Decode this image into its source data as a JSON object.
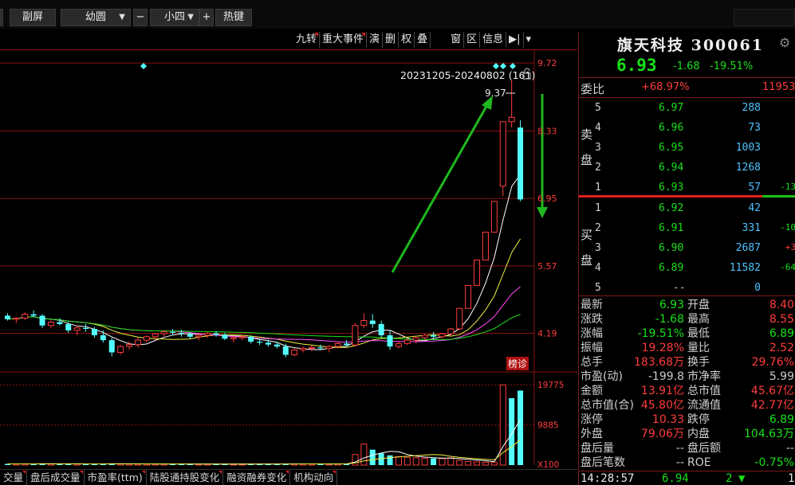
{
  "toolbar": {
    "sub_screen": "副屏",
    "font_family": "幼圆",
    "zoom_out": "−",
    "font_size": "小四",
    "zoom_in": "+",
    "hotkeys": "热键"
  },
  "chart_toolbar": {
    "items": [
      "九转",
      "重大事件",
      "演",
      "删",
      "权",
      "叠",
      "窗",
      "区",
      "信息"
    ],
    "arrow_icon": "skip-right-icon",
    "dropdown_icon": "chevron-down-icon"
  },
  "chart": {
    "range_label": "20231205-20240802 (161)",
    "lock_icon": "unlock-icon",
    "high_label": "9.37",
    "badge": "榜诊",
    "price_ticks": [
      "9.72",
      "8.33",
      "6.95",
      "5.57",
      "4.19"
    ],
    "volume_ticks": [
      "19775",
      "9885",
      "X100"
    ]
  },
  "chart_data": [
    {
      "type": "candlestick",
      "y_ticks": [
        4.19,
        5.57,
        6.95,
        8.33,
        9.72
      ],
      "ylim": [
        3.4,
        10.0
      ],
      "candles": [
        {
          "o": 4.55,
          "h": 4.6,
          "l": 4.45,
          "c": 4.48
        },
        {
          "o": 4.48,
          "h": 4.52,
          "l": 4.4,
          "c": 4.5
        },
        {
          "o": 4.5,
          "h": 4.62,
          "l": 4.46,
          "c": 4.58
        },
        {
          "o": 4.58,
          "h": 4.66,
          "l": 4.52,
          "c": 4.55
        },
        {
          "o": 4.55,
          "h": 4.58,
          "l": 4.3,
          "c": 4.35
        },
        {
          "o": 4.35,
          "h": 4.45,
          "l": 4.3,
          "c": 4.42
        },
        {
          "o": 4.42,
          "h": 4.5,
          "l": 4.35,
          "c": 4.38
        },
        {
          "o": 4.38,
          "h": 4.42,
          "l": 4.2,
          "c": 4.25
        },
        {
          "o": 4.25,
          "h": 4.35,
          "l": 4.15,
          "c": 4.3
        },
        {
          "o": 4.3,
          "h": 4.38,
          "l": 4.22,
          "c": 4.28
        },
        {
          "o": 4.28,
          "h": 4.32,
          "l": 4.1,
          "c": 4.15
        },
        {
          "o": 4.15,
          "h": 4.25,
          "l": 4.0,
          "c": 4.05
        },
        {
          "o": 4.05,
          "h": 4.1,
          "l": 3.72,
          "c": 3.8
        },
        {
          "o": 3.8,
          "h": 3.95,
          "l": 3.75,
          "c": 3.92
        },
        {
          "o": 3.92,
          "h": 4.02,
          "l": 3.85,
          "c": 3.96
        },
        {
          "o": 3.96,
          "h": 4.1,
          "l": 3.9,
          "c": 4.05
        },
        {
          "o": 4.05,
          "h": 4.15,
          "l": 4.0,
          "c": 4.12
        },
        {
          "o": 4.12,
          "h": 4.2,
          "l": 4.05,
          "c": 4.18
        },
        {
          "o": 4.18,
          "h": 4.25,
          "l": 4.12,
          "c": 4.22
        },
        {
          "o": 4.22,
          "h": 4.28,
          "l": 4.15,
          "c": 4.2
        },
        {
          "o": 4.2,
          "h": 4.26,
          "l": 4.12,
          "c": 4.18
        },
        {
          "o": 4.18,
          "h": 4.22,
          "l": 4.08,
          "c": 4.12
        },
        {
          "o": 4.12,
          "h": 4.2,
          "l": 4.05,
          "c": 4.15
        },
        {
          "o": 4.15,
          "h": 4.22,
          "l": 4.1,
          "c": 4.19
        },
        {
          "o": 4.19,
          "h": 4.24,
          "l": 4.12,
          "c": 4.16
        },
        {
          "o": 4.16,
          "h": 4.2,
          "l": 4.05,
          "c": 4.08
        },
        {
          "o": 4.08,
          "h": 4.14,
          "l": 4.0,
          "c": 4.1
        },
        {
          "o": 4.1,
          "h": 4.16,
          "l": 4.05,
          "c": 4.12
        },
        {
          "o": 4.12,
          "h": 4.15,
          "l": 3.98,
          "c": 4.02
        },
        {
          "o": 4.02,
          "h": 4.08,
          "l": 3.95,
          "c": 4.0
        },
        {
          "o": 4.0,
          "h": 4.06,
          "l": 3.92,
          "c": 3.96
        },
        {
          "o": 3.96,
          "h": 4.02,
          "l": 3.88,
          "c": 3.92
        },
        {
          "o": 3.92,
          "h": 3.98,
          "l": 3.7,
          "c": 3.75
        },
        {
          "o": 3.75,
          "h": 3.88,
          "l": 3.72,
          "c": 3.85
        },
        {
          "o": 3.85,
          "h": 3.92,
          "l": 3.8,
          "c": 3.88
        },
        {
          "o": 3.88,
          "h": 3.94,
          "l": 3.82,
          "c": 3.9
        },
        {
          "o": 3.9,
          "h": 3.96,
          "l": 3.85,
          "c": 3.88
        },
        {
          "o": 3.88,
          "h": 3.95,
          "l": 3.8,
          "c": 3.92
        },
        {
          "o": 3.92,
          "h": 4.02,
          "l": 3.88,
          "c": 3.98
        },
        {
          "o": 3.98,
          "h": 4.05,
          "l": 3.92,
          "c": 3.95
        },
        {
          "o": 3.95,
          "h": 4.4,
          "l": 3.92,
          "c": 4.35
        },
        {
          "o": 4.35,
          "h": 4.6,
          "l": 4.3,
          "c": 4.45
        },
        {
          "o": 4.45,
          "h": 4.58,
          "l": 4.3,
          "c": 4.38
        },
        {
          "o": 4.38,
          "h": 4.45,
          "l": 4.1,
          "c": 4.15
        },
        {
          "o": 4.15,
          "h": 4.25,
          "l": 3.85,
          "c": 3.92
        },
        {
          "o": 3.92,
          "h": 4.02,
          "l": 3.88,
          "c": 3.98
        },
        {
          "o": 3.98,
          "h": 4.08,
          "l": 3.95,
          "c": 4.05
        },
        {
          "o": 4.05,
          "h": 4.12,
          "l": 3.98,
          "c": 4.1
        },
        {
          "o": 4.1,
          "h": 4.18,
          "l": 4.05,
          "c": 4.15
        },
        {
          "o": 4.15,
          "h": 4.22,
          "l": 4.08,
          "c": 4.12
        },
        {
          "o": 4.12,
          "h": 4.2,
          "l": 4.08,
          "c": 4.18
        },
        {
          "o": 4.18,
          "h": 4.3,
          "l": 4.15,
          "c": 4.28
        },
        {
          "o": 4.28,
          "h": 4.7,
          "l": 4.25,
          "c": 4.7
        },
        {
          "o": 4.7,
          "h": 5.17,
          "l": 4.7,
          "c": 5.17
        },
        {
          "o": 5.17,
          "h": 5.69,
          "l": 5.17,
          "c": 5.69
        },
        {
          "o": 5.69,
          "h": 6.26,
          "l": 5.69,
          "c": 6.26
        },
        {
          "o": 6.26,
          "h": 6.89,
          "l": 6.26,
          "c": 6.89
        },
        {
          "o": 7.2,
          "h": 8.52,
          "l": 7.0,
          "c": 8.52
        },
        {
          "o": 8.52,
          "h": 9.37,
          "l": 8.4,
          "c": 8.61
        },
        {
          "o": 8.4,
          "h": 8.55,
          "l": 6.89,
          "c": 6.93
        }
      ]
    },
    {
      "type": "bar",
      "title": "volume",
      "y_ticks": [
        9885,
        19775
      ],
      "ylim": [
        0,
        21000
      ],
      "values": [
        300,
        280,
        320,
        290,
        350,
        300,
        280,
        310,
        290,
        270,
        300,
        320,
        360,
        300,
        280,
        270,
        260,
        290,
        280,
        270,
        260,
        250,
        270,
        280,
        260,
        250,
        260,
        270,
        280,
        300,
        290,
        270,
        350,
        300,
        280,
        270,
        260,
        280,
        300,
        320,
        2600,
        5200,
        3800,
        2900,
        2400,
        2100,
        1900,
        1800,
        1700,
        1650,
        1600,
        1800,
        1200,
        900,
        800,
        700,
        650,
        19775,
        16500,
        18368
      ],
      "directions": [
        0,
        1,
        1,
        0,
        0,
        1,
        0,
        0,
        1,
        0,
        0,
        0,
        0,
        1,
        1,
        1,
        1,
        1,
        1,
        0,
        0,
        0,
        1,
        1,
        0,
        0,
        1,
        1,
        0,
        0,
        0,
        0,
        0,
        1,
        1,
        1,
        0,
        1,
        1,
        0,
        1,
        1,
        0,
        0,
        0,
        1,
        1,
        1,
        1,
        0,
        1,
        1,
        1,
        1,
        1,
        1,
        1,
        1,
        0,
        0
      ]
    }
  ],
  "quote": {
    "name_code": "旗天科技 300061",
    "gear_icon": "gear-icon",
    "price": "6.93",
    "change": "-1.68",
    "change_pct": "-19.51%",
    "weibi_label": "委比",
    "weibi_pct": "+68.97%",
    "weibi_diff": "11953",
    "sell_label": [
      "卖",
      "盘"
    ],
    "buy_label": [
      "买",
      "盘"
    ],
    "sell": [
      {
        "lvl": "5",
        "px": "6.97",
        "vol": "288",
        "delta": ""
      },
      {
        "lvl": "4",
        "px": "6.96",
        "vol": "73",
        "delta": ""
      },
      {
        "lvl": "3",
        "px": "6.95",
        "vol": "1003",
        "delta": ""
      },
      {
        "lvl": "2",
        "px": "6.94",
        "vol": "1268",
        "delta": ""
      },
      {
        "lvl": "1",
        "px": "6.93",
        "vol": "57",
        "delta": "-13"
      }
    ],
    "buy": [
      {
        "lvl": "1",
        "px": "6.92",
        "vol": "42",
        "delta": "",
        "dir": "neg"
      },
      {
        "lvl": "2",
        "px": "6.91",
        "vol": "331",
        "delta": "-10",
        "dir": "neg"
      },
      {
        "lvl": "3",
        "px": "6.90",
        "vol": "2687",
        "delta": "+3",
        "dir": "pos"
      },
      {
        "lvl": "4",
        "px": "6.89",
        "vol": "11582",
        "delta": "-64",
        "dir": "neg"
      },
      {
        "lvl": "5",
        "px": "--",
        "vol": "0",
        "delta": "",
        "dir": "neg"
      }
    ],
    "stats": [
      {
        "k1": "最新",
        "v1": "6.93",
        "c1": "c-green",
        "k2": "开盘",
        "v2": "8.40",
        "c2": "c-red"
      },
      {
        "k1": "涨跌",
        "v1": "-1.68",
        "c1": "c-green",
        "k2": "最高",
        "v2": "8.55",
        "c2": "c-red"
      },
      {
        "k1": "涨幅",
        "v1": "-19.51%",
        "c1": "c-green",
        "k2": "最低",
        "v2": "6.89",
        "c2": "c-green"
      },
      {
        "k1": "振幅",
        "v1": "19.28%",
        "c1": "c-red",
        "k2": "量比",
        "v2": "2.52",
        "c2": "c-red"
      },
      {
        "k1": "总手",
        "v1": "183.68万",
        "c1": "c-red",
        "k2": "换手",
        "v2": "29.76%",
        "c2": "c-red"
      },
      {
        "k1": "市盈(动)",
        "v1": "-199.8",
        "c1": "c-gray",
        "k2": "市净率",
        "v2": "5.99",
        "c2": "c-gray"
      },
      {
        "k1": "金额",
        "v1": "13.91亿",
        "c1": "c-red",
        "k2": "总市值",
        "v2": "45.67亿",
        "c2": "c-red"
      },
      {
        "k1": "总市值(合)",
        "v1": "45.80亿",
        "c1": "c-red",
        "k2": "流通值",
        "v2": "42.77亿",
        "c2": "c-red"
      },
      {
        "k1": "涨停",
        "v1": "10.33",
        "c1": "c-red",
        "k2": "跌停",
        "v2": "6.89",
        "c2": "c-green"
      },
      {
        "k1": "外盘",
        "v1": "79.06万",
        "c1": "c-red",
        "k2": "内盘",
        "v2": "104.63万",
        "c2": "c-green"
      },
      {
        "k1": "盘后量",
        "v1": "--",
        "c1": "c-gray",
        "k2": "盘后额",
        "v2": "--",
        "c2": "c-gray"
      },
      {
        "k1": "盘后笔数",
        "v1": "--",
        "c1": "c-gray",
        "k2": "ROE",
        "v2": "-0.75%",
        "c2": "c-green"
      }
    ],
    "tick": {
      "time": "14:28:57",
      "price": "6.94",
      "vol": "2",
      "arrow_icon": "down-arrow-icon",
      "extra": "1"
    }
  },
  "bottom_tabs": [
    "交量",
    "盘后成交量",
    "市盈率(ttm)",
    "陆股通持股变化",
    "融资融券变化",
    "机构动向"
  ],
  "colors": {
    "up": "#ff3c3c",
    "down": "#19e019",
    "down_fill": "#54ffff",
    "grid": "#8a1010",
    "ma5": "#ffffff",
    "ma10": "#f0f040",
    "ma20": "#ff50ff",
    "ma60": "#19e019"
  }
}
